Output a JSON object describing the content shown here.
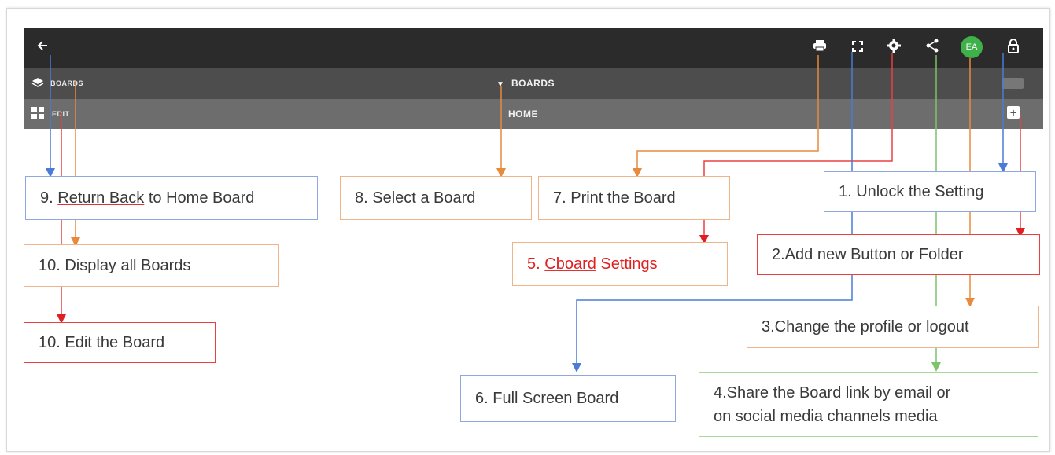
{
  "toolbar": {
    "back_icon": "arrow-left-icon",
    "right_icons": [
      "print-icon",
      "fullscreen-icon",
      "settings-icon",
      "share-icon",
      "avatar",
      "lock-icon"
    ],
    "avatar_initials": "EA"
  },
  "boards_bar": {
    "left_label": "BOARDS",
    "center_label": "BOARDS"
  },
  "home_bar": {
    "left_label": "EDIT",
    "center_label": "HOME"
  },
  "callouts": {
    "c9": {
      "prefix": "9. ",
      "underlined": "Return Back",
      "suffix": " to Home Board"
    },
    "c8": "8. Select a Board",
    "c7": "7. Print the Board",
    "c1": "1. Unlock the Setting",
    "c10a": "10. Display all Boards",
    "c5": {
      "prefix": "5. ",
      "underlined": "Cboard",
      "suffix": " Settings"
    },
    "c2": "2.Add new Button or Folder",
    "c10b": "10. Edit the Board",
    "c3": "3.Change the profile or logout",
    "c6": "6. Full Screen Board",
    "c4_line1": "4.Share the Board link by email or",
    "c4_line2": "on social media channels media"
  },
  "colors": {
    "blue": "#4a7bd8",
    "orange": "#e88a3c",
    "red": "#e02020",
    "green": "#7cc36a"
  }
}
